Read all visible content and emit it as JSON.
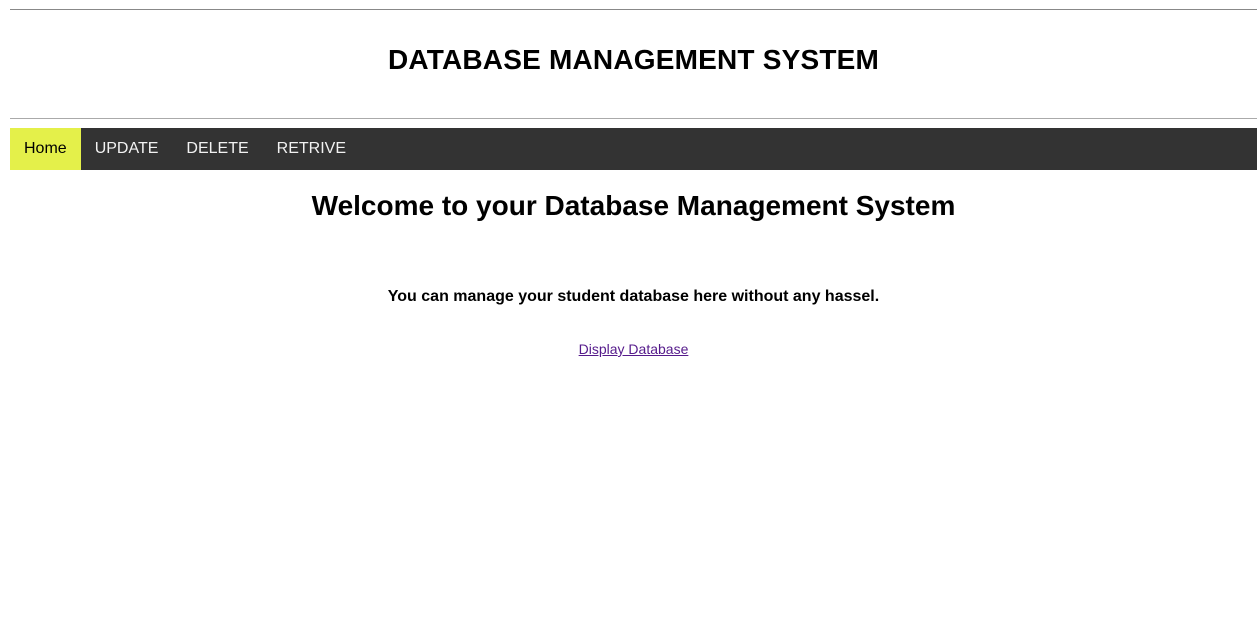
{
  "header": {
    "title": "DATABASE MANAGEMENT SYSTEM"
  },
  "nav": {
    "items": [
      {
        "label": "Home",
        "active": true
      },
      {
        "label": "UPDATE",
        "active": false
      },
      {
        "label": "DELETE",
        "active": false
      },
      {
        "label": "RETRIVE",
        "active": false
      }
    ]
  },
  "main": {
    "welcome": "Welcome to your Database Management System",
    "tagline": "You can manage your student database here without any hassel.",
    "link_label": "Display Database"
  },
  "colors": {
    "nav_background": "#333333",
    "nav_active": "#e4f04a",
    "visited_link": "#551a8b"
  }
}
